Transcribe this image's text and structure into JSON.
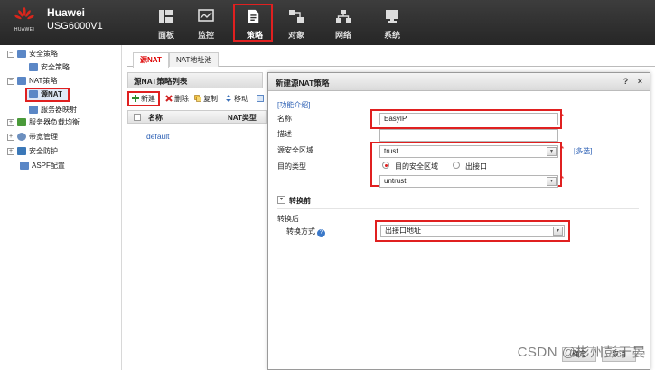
{
  "brand": {
    "logo_text": "HUAWEI",
    "vendor": "Huawei",
    "model": "USG6000V1"
  },
  "nav": [
    {
      "label": "面板",
      "icon": "dashboard-icon"
    },
    {
      "label": "监控",
      "icon": "monitor-icon"
    },
    {
      "label": "策略",
      "icon": "policy-icon",
      "active": true
    },
    {
      "label": "对象",
      "icon": "object-icon"
    },
    {
      "label": "网络",
      "icon": "network-icon"
    },
    {
      "label": "系统",
      "icon": "system-icon"
    }
  ],
  "tree": {
    "security_policy": "安全策略",
    "security_policy_child": "安全策略",
    "nat_policy": "NAT策略",
    "source_nat": "源NAT",
    "server_mapping": "服务器映射",
    "server_lb": "服务器负载均衡",
    "bandwidth": "带宽管理",
    "security_protection": "安全防护",
    "aspf": "ASPF配置"
  },
  "tabs": {
    "source_nat": "源NAT",
    "nat_pool": "NAT地址池"
  },
  "list": {
    "title": "源NAT策略列表",
    "toolbar": {
      "new": "新建",
      "delete": "删除",
      "copy": "复制",
      "move": "移动"
    },
    "columns": {
      "name": "名称",
      "nat_type": "NAT类型"
    },
    "rows": [
      "default"
    ]
  },
  "dialog": {
    "title": "新建源NAT策略",
    "help_btn": "?",
    "close_btn": "×",
    "intro_link": "[功能介绍]",
    "name_label": "名称",
    "name_value": "EasyIP",
    "desc_label": "描述",
    "desc_value": "",
    "src_zone_label": "源安全区域",
    "src_zone_value": "trust",
    "multi_select": "[多选]",
    "dest_type_label": "目的类型",
    "dest_type_opt1": "目的安全区域",
    "dest_type_opt2": "出接口",
    "dest_zone_value": "untrust",
    "before_section": "转换前",
    "after_section": "转换后",
    "conv_mode_label": "转换方式",
    "conv_mode_value": "出接口地址",
    "ok": "确定",
    "cancel": "取消"
  },
  "colors": {
    "accent_red": "#e02020",
    "link_blue": "#2b5fb4",
    "topbar": "#2f2f2f"
  },
  "watermark": "CSDN @彬州彭于晏"
}
